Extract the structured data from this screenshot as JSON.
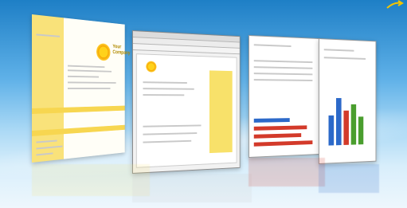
{
  "letter": {
    "company": "Your Company"
  },
  "colors": {
    "yellow": "#f9e27a",
    "blue": "#2c69c9",
    "red": "#d33a2a",
    "green": "#4a9e2e"
  },
  "icons": [
    "sun-logo-icon",
    "arrow-icon"
  ]
}
